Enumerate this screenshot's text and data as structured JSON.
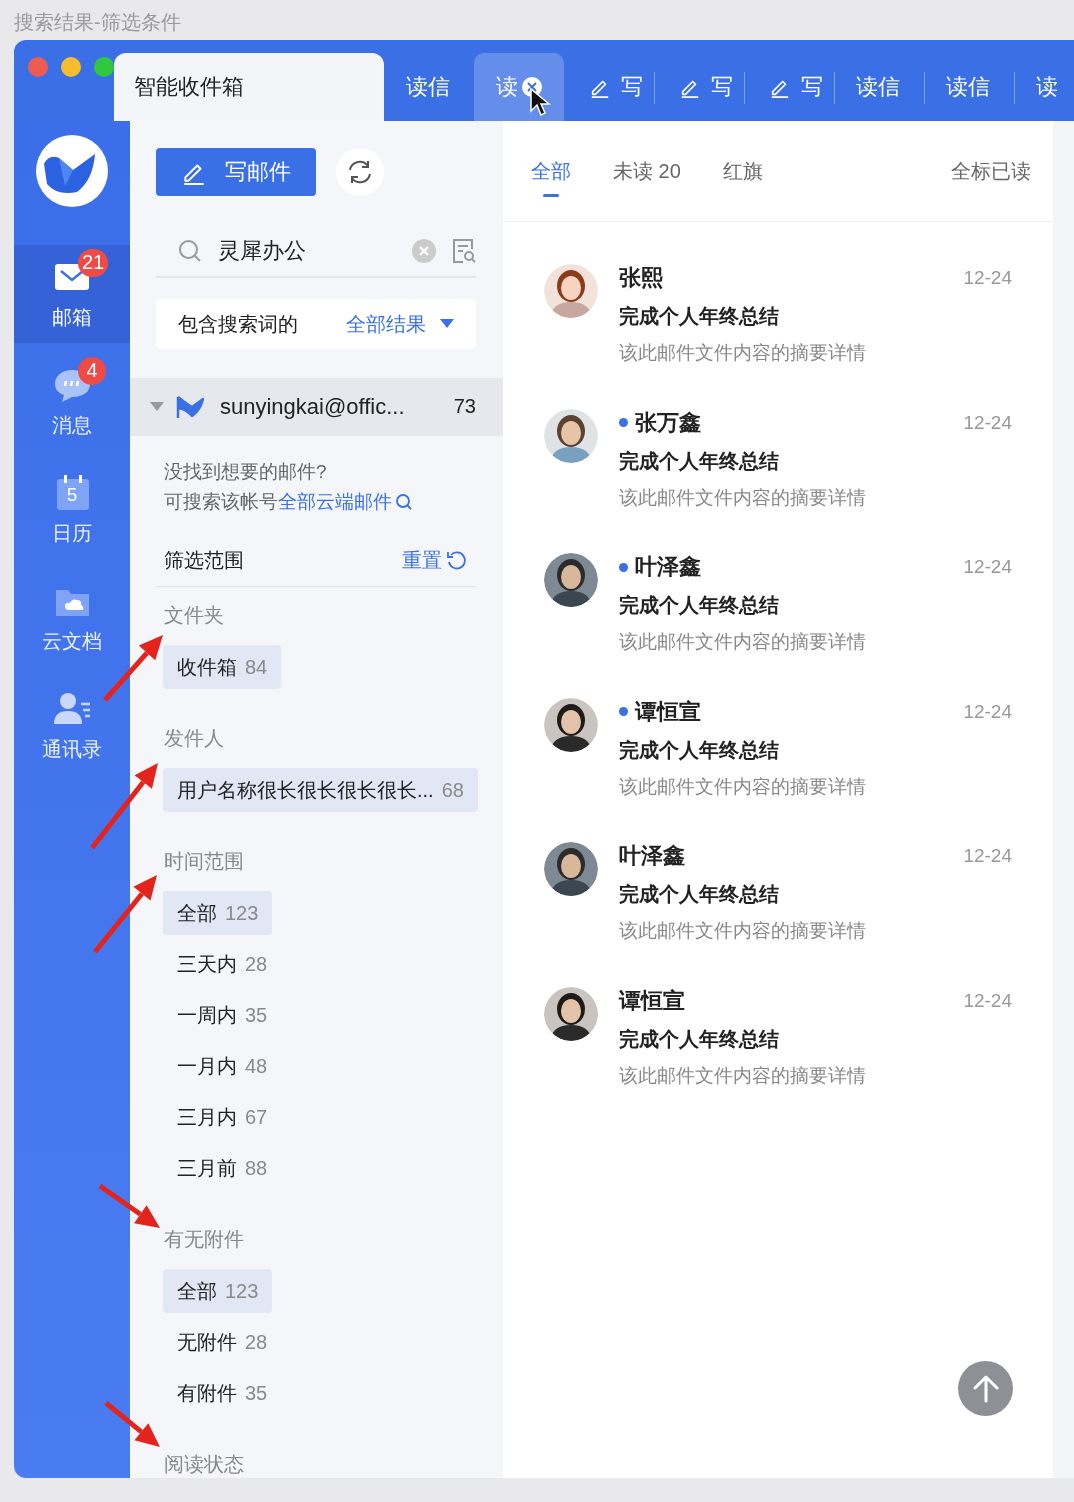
{
  "caption": "搜索结果-筛选条件",
  "tabs": [
    {
      "label": "智能收件箱",
      "kind": "home",
      "selected": true,
      "hovered": false
    },
    {
      "label": "读信",
      "kind": "read",
      "selected": false,
      "hovered": false
    },
    {
      "label": "读",
      "kind": "read",
      "selected": false,
      "hovered": true
    },
    {
      "label": "写",
      "kind": "compose",
      "selected": false,
      "hovered": false
    },
    {
      "label": "写",
      "kind": "compose",
      "selected": false,
      "hovered": false
    },
    {
      "label": "写",
      "kind": "compose",
      "selected": false,
      "hovered": false
    },
    {
      "label": "读信",
      "kind": "read",
      "selected": false,
      "hovered": false
    },
    {
      "label": "读信",
      "kind": "read",
      "selected": false,
      "hovered": false
    },
    {
      "label": "读",
      "kind": "read",
      "selected": false,
      "hovered": false
    }
  ],
  "nav": [
    {
      "label": "邮箱",
      "kind": "mail",
      "badge": "21",
      "selected": true
    },
    {
      "label": "消息",
      "kind": "chat",
      "badge": "4",
      "selected": false
    },
    {
      "label": "日历",
      "kind": "calendar",
      "date": "5",
      "selected": false
    },
    {
      "label": "云文档",
      "kind": "docs",
      "selected": false
    },
    {
      "label": "通讯录",
      "kind": "contacts",
      "selected": false
    }
  ],
  "compose_button": "写邮件",
  "search": {
    "value": "灵犀办公"
  },
  "scope": {
    "label": "包含搜索词的",
    "value": "全部结果"
  },
  "account": {
    "name": "sunyingkai@offic...",
    "count": "73",
    "expanded": true
  },
  "hint": {
    "line1": "没找到想要的邮件?",
    "line2": "可搜索该帐号",
    "link": "全部云端邮件"
  },
  "filter_header": {
    "title": "筛选范围",
    "reset": "重置"
  },
  "filter_sections": [
    {
      "title": "文件夹",
      "options": [
        {
          "label": "收件箱",
          "count": "84",
          "selected": true
        }
      ]
    },
    {
      "title": "发件人",
      "options": [
        {
          "label": "用户名称很长很长很长很长...",
          "count": "68",
          "selected": true
        }
      ]
    },
    {
      "title": "时间范围",
      "options": [
        {
          "label": "全部",
          "count": "123",
          "selected": true
        },
        {
          "label": "三天内",
          "count": "28",
          "selected": false
        },
        {
          "label": "一周内",
          "count": "35",
          "selected": false
        },
        {
          "label": "一月内",
          "count": "48",
          "selected": false
        },
        {
          "label": "三月内",
          "count": "67",
          "selected": false
        },
        {
          "label": "三月前",
          "count": "88",
          "selected": false
        }
      ]
    },
    {
      "title": "有无附件",
      "options": [
        {
          "label": "全部",
          "count": "123",
          "selected": true
        },
        {
          "label": "无附件",
          "count": "28",
          "selected": false
        },
        {
          "label": "有附件",
          "count": "35",
          "selected": false
        }
      ]
    },
    {
      "title": "阅读状态"
    }
  ],
  "list_tabs": [
    {
      "label": "全部",
      "selected": true
    },
    {
      "label": "未读 20",
      "selected": false
    },
    {
      "label": "红旗",
      "selected": false
    }
  ],
  "mark_all_read": "全标已读",
  "mails": [
    {
      "sender": "张熙",
      "unread": false,
      "date": "12-24",
      "subject": "完成个人年终总结",
      "summary": "该此邮件文件内容的摘要详情"
    },
    {
      "sender": "张万鑫",
      "unread": true,
      "date": "12-24",
      "subject": "完成个人年终总结",
      "summary": "该此邮件文件内容的摘要详情"
    },
    {
      "sender": "叶泽鑫",
      "unread": true,
      "date": "12-24",
      "subject": "完成个人年终总结",
      "summary": "该此邮件文件内容的摘要详情"
    },
    {
      "sender": "谭恒宣",
      "unread": true,
      "date": "12-24",
      "subject": "完成个人年终总结",
      "summary": "该此邮件文件内容的摘要详情"
    },
    {
      "sender": "叶泽鑫",
      "unread": false,
      "date": "12-24",
      "subject": "完成个人年终总结",
      "summary": "该此邮件文件内容的摘要详情"
    },
    {
      "sender": "谭恒宣",
      "unread": false,
      "date": "12-24",
      "subject": "完成个人年终总结",
      "summary": "该此邮件文件内容的摘要详情"
    }
  ]
}
